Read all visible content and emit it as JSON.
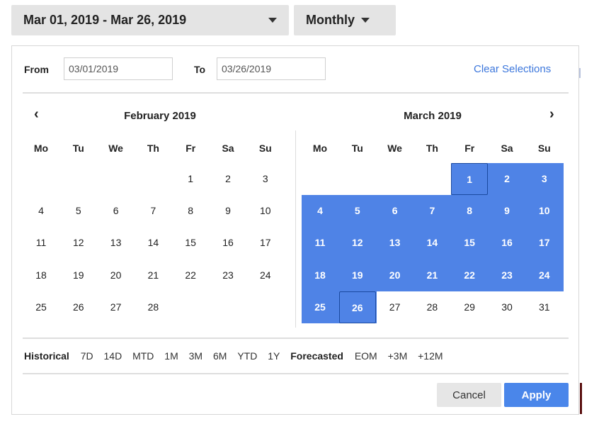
{
  "range_button": {
    "label": "Mar 01, 2019 - Mar 26, 2019",
    "icon": "caret-down-icon"
  },
  "period_button": {
    "label": "Monthly",
    "icon": "caret-down-icon"
  },
  "from": {
    "label": "From",
    "value": "03/01/2019"
  },
  "to": {
    "label": "To",
    "value": "03/26/2019"
  },
  "clear_label": "Clear Selections",
  "nav": {
    "prev": "‹",
    "next": "›"
  },
  "weekdays": [
    "Mo",
    "Tu",
    "We",
    "Th",
    "Fr",
    "Sa",
    "Su"
  ],
  "calendars": [
    {
      "title": "February 2019",
      "weeks": [
        [
          "",
          "",
          "",
          "",
          "1",
          "2",
          "3"
        ],
        [
          "4",
          "5",
          "6",
          "7",
          "8",
          "9",
          "10"
        ],
        [
          "11",
          "12",
          "13",
          "14",
          "15",
          "16",
          "17"
        ],
        [
          "18",
          "19",
          "20",
          "21",
          "22",
          "23",
          "24"
        ],
        [
          "25",
          "26",
          "27",
          "28",
          "",
          "",
          ""
        ]
      ]
    },
    {
      "title": "March 2019",
      "weeks": [
        [
          "",
          "",
          "",
          "",
          "1",
          "2",
          "3"
        ],
        [
          "4",
          "5",
          "6",
          "7",
          "8",
          "9",
          "10"
        ],
        [
          "11",
          "12",
          "13",
          "14",
          "15",
          "16",
          "17"
        ],
        [
          "18",
          "19",
          "20",
          "21",
          "22",
          "23",
          "24"
        ],
        [
          "25",
          "26",
          "27",
          "28",
          "29",
          "30",
          "31"
        ]
      ]
    }
  ],
  "selection": {
    "start": "03/01/2019",
    "end": "03/26/2019"
  },
  "presets": {
    "historical_label": "Historical",
    "historical": [
      "7D",
      "14D",
      "MTD",
      "1M",
      "3M",
      "6M",
      "YTD",
      "1Y"
    ],
    "forecasted_label": "Forecasted",
    "forecasted": [
      "EOM",
      "+3M",
      "+12M"
    ]
  },
  "cancel_label": "Cancel",
  "apply_label": "Apply",
  "colors": {
    "selection": "#4f83e6",
    "link": "#3c77dc",
    "apply": "#4a86ea"
  }
}
